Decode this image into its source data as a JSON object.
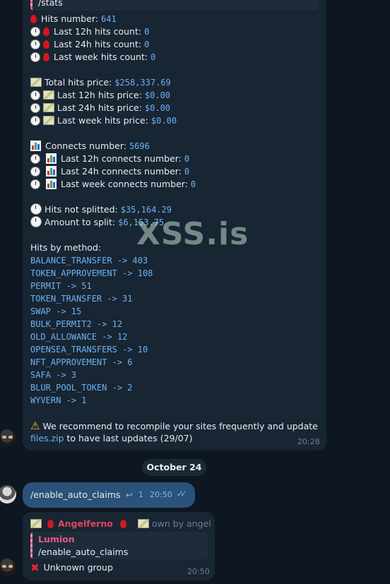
{
  "stats_message": {
    "command": "/stats",
    "hits_number_label": "Hits number:",
    "hits_number": "641",
    "hits_12h_label": "Last 12h hits count:",
    "hits_12h": "0",
    "hits_24h_label": "Last 24h hits count:",
    "hits_24h": "0",
    "hits_week_label": "Last week hits count:",
    "hits_week": "0",
    "total_price_label": "Total hits price:",
    "total_price": "$258,337.69",
    "price_12h_label": "Last 12h hits price:",
    "price_12h": "$0.00",
    "price_24h_label": "Last 24h hits price:",
    "price_24h": "$0.00",
    "price_week_label": "Last week hits price:",
    "price_week": "$0.00",
    "connects_label": "Connects number:",
    "connects": "5696",
    "connects_12h_label": "Last 12h connects number:",
    "connects_12h": "0",
    "connects_24h_label": "Last 24h connects number:",
    "connects_24h": "0",
    "connects_week_label": "Last week connects number:",
    "connects_week": "0",
    "not_splitted_label": "Hits not splitted:",
    "not_splitted": "$35,164.29",
    "to_split_label": "Amount to split:",
    "to_split": "$6,153.75",
    "methods_title": "Hits by method:",
    "methods": [
      "BALANCE_TRANSFER -> 403",
      "TOKEN_APPROVEMENT -> 108",
      "PERMIT -> 51",
      "TOKEN_TRANSFER -> 31",
      "SWAP -> 15",
      "BULK_PERMIT2 -> 12",
      "OLD_ALLOWANCE -> 12",
      "OPENSEA_TRANSFERS -> 10",
      "NFT_APPROVEMENT -> 6",
      "SAFA -> 3",
      "BLUR_POOL_TOKEN -> 2",
      "WYVERN -> 1"
    ],
    "recommend_text": "We recommend to recompile your sites frequently and update",
    "files_link": "files.zip",
    "recommend_tail": "to have last updates (29/07)",
    "time": "20:28"
  },
  "watermark": "XSS.is",
  "date_separator": "October 24",
  "outgoing_message": {
    "text": "/enable_auto_claims",
    "reply_count": "1",
    "time": "20:50"
  },
  "bot_reply": {
    "sender": "Angelferno",
    "tag": "own by angel",
    "quoted_name": "Lumion",
    "quoted_text": "/enable_auto_claims",
    "text": "Unknown group",
    "time": "20:50"
  },
  "colors": {
    "background": "#0e1621",
    "incoming_bubble": "#182533",
    "outgoing_bubble": "#2b5278",
    "accent_blue": "#6ab3f3",
    "sender_red": "#e0465f"
  }
}
